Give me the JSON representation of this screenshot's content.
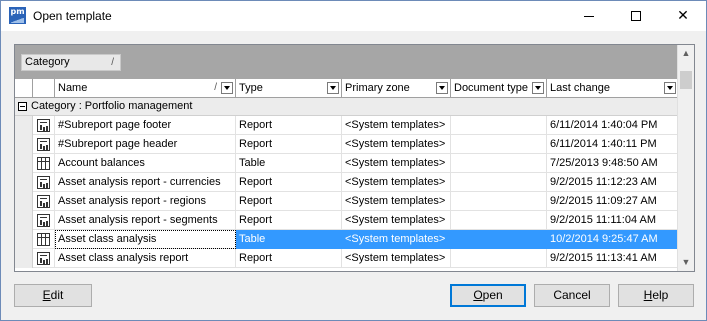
{
  "window": {
    "title": "Open template",
    "app_icon_text": "pm",
    "controls": {
      "minimize": "minimize-icon",
      "maximize": "maximize-icon",
      "close": "✕"
    }
  },
  "grid": {
    "group_by_chip": {
      "label": "Category",
      "sort_glyph": "/"
    },
    "columns": [
      {
        "label": "Name",
        "sort_glyph": "/"
      },
      {
        "label": "Type"
      },
      {
        "label": "Primary zone"
      },
      {
        "label": "Document type"
      },
      {
        "label": "Last change"
      }
    ],
    "group_row": {
      "label": "Category : Portfolio management",
      "expanded": true
    },
    "rows": [
      {
        "icon": "report-icon",
        "name": "#Subreport page footer",
        "type": "Report",
        "zone": "<System templates>",
        "doc_type": "",
        "last_change": "6/11/2014 1:40:04 PM",
        "selected": false
      },
      {
        "icon": "report-icon",
        "name": "#Subreport page header",
        "type": "Report",
        "zone": "<System templates>",
        "doc_type": "",
        "last_change": "6/11/2014 1:40:11 PM",
        "selected": false
      },
      {
        "icon": "table-icon",
        "name": "Account balances",
        "type": "Table",
        "zone": "<System templates>",
        "doc_type": "",
        "last_change": "7/25/2013 9:48:50 AM",
        "selected": false
      },
      {
        "icon": "report-icon",
        "name": "Asset analysis report - currencies",
        "type": "Report",
        "zone": "<System templates>",
        "doc_type": "",
        "last_change": "9/2/2015 11:12:23 AM",
        "selected": false
      },
      {
        "icon": "report-icon",
        "name": "Asset analysis report - regions",
        "type": "Report",
        "zone": "<System templates>",
        "doc_type": "",
        "last_change": "9/2/2015 11:09:27 AM",
        "selected": false
      },
      {
        "icon": "report-icon",
        "name": "Asset analysis report - segments",
        "type": "Report",
        "zone": "<System templates>",
        "doc_type": "",
        "last_change": "9/2/2015 11:11:04 AM",
        "selected": false
      },
      {
        "icon": "table-icon",
        "name": "Asset class analysis",
        "type": "Table",
        "zone": "<System templates>",
        "doc_type": "",
        "last_change": "10/2/2014 9:25:47 AM",
        "selected": true
      },
      {
        "icon": "report-icon",
        "name": "Asset class analysis report",
        "type": "Report",
        "zone": "<System templates>",
        "doc_type": "",
        "last_change": "9/2/2015 11:13:41 AM",
        "selected": false
      }
    ]
  },
  "buttons": {
    "edit": {
      "mnemonic": "E",
      "rest": "dit"
    },
    "open": {
      "mnemonic": "O",
      "rest": "pen"
    },
    "cancel": {
      "label": "Cancel"
    },
    "help": {
      "mnemonic": "H",
      "rest": "elp"
    }
  },
  "colors": {
    "selection": "#3399ff",
    "default_button_border": "#0078d7",
    "groupbar": "#a6a6a6"
  }
}
